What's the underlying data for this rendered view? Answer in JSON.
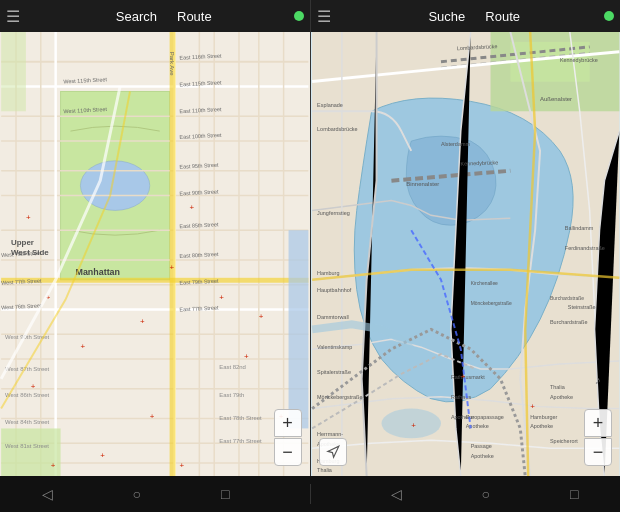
{
  "panels": [
    {
      "id": "nyc",
      "nav": {
        "menu_icon": "☰",
        "search_label": "Search",
        "route_label": "Route",
        "status_dot_color": "#4cd964"
      },
      "zoom_plus": "+",
      "zoom_minus": "−",
      "android_nav": {
        "back": "◁",
        "home": "○",
        "recents": "□"
      }
    },
    {
      "id": "hamburg",
      "nav": {
        "menu_icon": "☰",
        "search_label": "Suche",
        "route_label": "Route",
        "status_dot_color": "#4cd964"
      },
      "zoom_plus": "+",
      "zoom_minus": "−",
      "location_icon": "◁",
      "android_nav": {
        "back": "◁",
        "home": "○",
        "recents": "□"
      }
    }
  ]
}
